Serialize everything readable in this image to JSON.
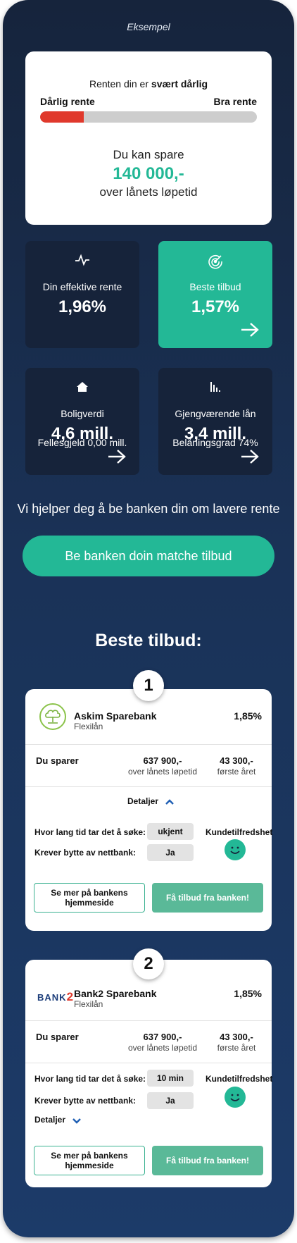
{
  "header": {
    "badge": "Eksempel"
  },
  "rate_card": {
    "rating_prefix": "Renten din er",
    "rating_value": "svært dårlig",
    "left_label": "Dårlig rente",
    "right_label": "Bra rente",
    "rating_fraction": 0.2,
    "save_label": "Du kan spare",
    "save_amount": "140 000,-",
    "save_period": "over lånets løpetid"
  },
  "tiles": {
    "effective_label": "Din effektive rente",
    "effective_value": "1,96%",
    "best_label": "Beste tilbud",
    "best_value": "1,57%",
    "home_label": "Boligverdi",
    "home_value": "4,6 mill.",
    "home_sub": "Fellesgjeld 0,00 mill.",
    "loan_label": "Gjengværende lån",
    "loan_value": "3,4 mill.",
    "loan_sub": "Belåningsgrad 74%"
  },
  "help_text": "Vi hjelper deg å be banken din om lavere rente",
  "cta_label": "Be banken doin matche tilbud",
  "offers_title": "Beste tilbud:",
  "offers": [
    {
      "rank": "1",
      "bank": "Askim Sparebank",
      "product": "Flexilån",
      "rate": "1,85%",
      "save_label": "Du sparer",
      "total_amount": "637 900,-",
      "total_sub": "over lånets løpetid",
      "year_amount": "43 300,-",
      "year_sub": "første året",
      "details_label": "Detaljer",
      "q_time": "Hvor lang tid tar det å søke:",
      "time_value": "ukjent",
      "q_switch": "Krever bytte av nettbank:",
      "switch_value": "Ja",
      "satisfaction_label": "Kundetilfredshet",
      "more_label": "Se mer på bankens hjemmeside",
      "offer_label": "Få tilbud fra banken!"
    },
    {
      "rank": "2",
      "bank": "Bank2 Sparebank",
      "product": "Flexilån",
      "rate": "1,85%",
      "save_label": "Du sparer",
      "total_amount": "637 900,-",
      "total_sub": "over lånets løpetid",
      "year_amount": "43 300,-",
      "year_sub": "første året",
      "details_label": "Detaljer",
      "q_time": "Hvor lang tid tar det å søke:",
      "time_value": "10 min",
      "q_switch": "Krever bytte av nettbank:",
      "switch_value": "Ja",
      "satisfaction_label": "Kundetilfredshet",
      "more_label": "Se mer på bankens hjemmeside",
      "offer_label": "Få tilbud fra banken!",
      "logo_text": "BANK",
      "logo_num": "2"
    }
  ],
  "colors": {
    "teal": "#23b896",
    "navy": "#16233a",
    "red": "#e0392c"
  }
}
